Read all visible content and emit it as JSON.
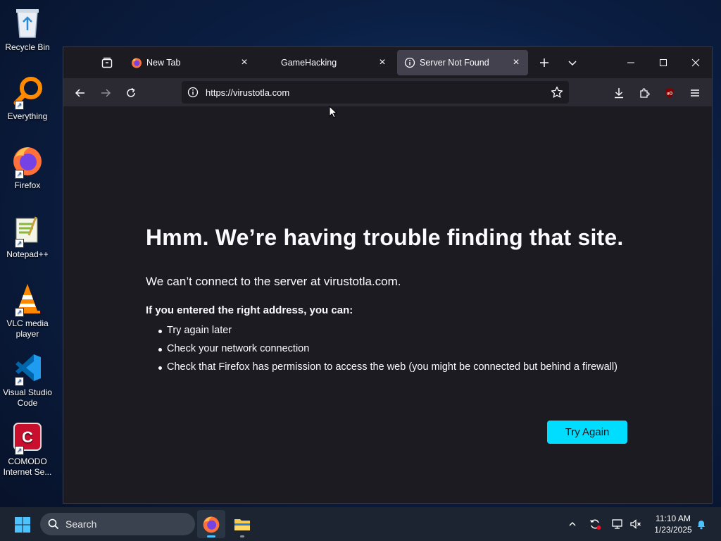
{
  "desktop": {
    "icons": [
      {
        "label": "Recycle Bin"
      },
      {
        "label": "Everything"
      },
      {
        "label": "Firefox"
      },
      {
        "label": "Notepad++"
      },
      {
        "label": "VLC media player"
      },
      {
        "label": "Visual Studio Code"
      },
      {
        "label": "COMODO Internet Se..."
      }
    ]
  },
  "browser": {
    "tabs": [
      {
        "title": "New Tab",
        "icon": "firefox-icon"
      },
      {
        "title": "GameHacking",
        "icon": "none"
      },
      {
        "title": "Server Not Found",
        "icon": "info-icon",
        "active": true
      }
    ],
    "url": "https://virustotla.com"
  },
  "error_page": {
    "title": "Hmm. We’re having trouble finding that site.",
    "description": "We can’t connect to the server at virustotla.com.",
    "lead": "If you entered the right address, you can:",
    "suggestions": [
      "Try again later",
      "Check your network connection",
      "Check that Firefox has permission to access the web (you might be connected but behind a firewall)"
    ],
    "button_label": "Try Again"
  },
  "taskbar": {
    "search_label": "Search",
    "time": "11:10 AM",
    "date": "1/23/2025"
  },
  "colors": {
    "accent": "#00ddff",
    "page_bg": "#1c1b22",
    "toolbar_bg": "#2b2a33"
  }
}
